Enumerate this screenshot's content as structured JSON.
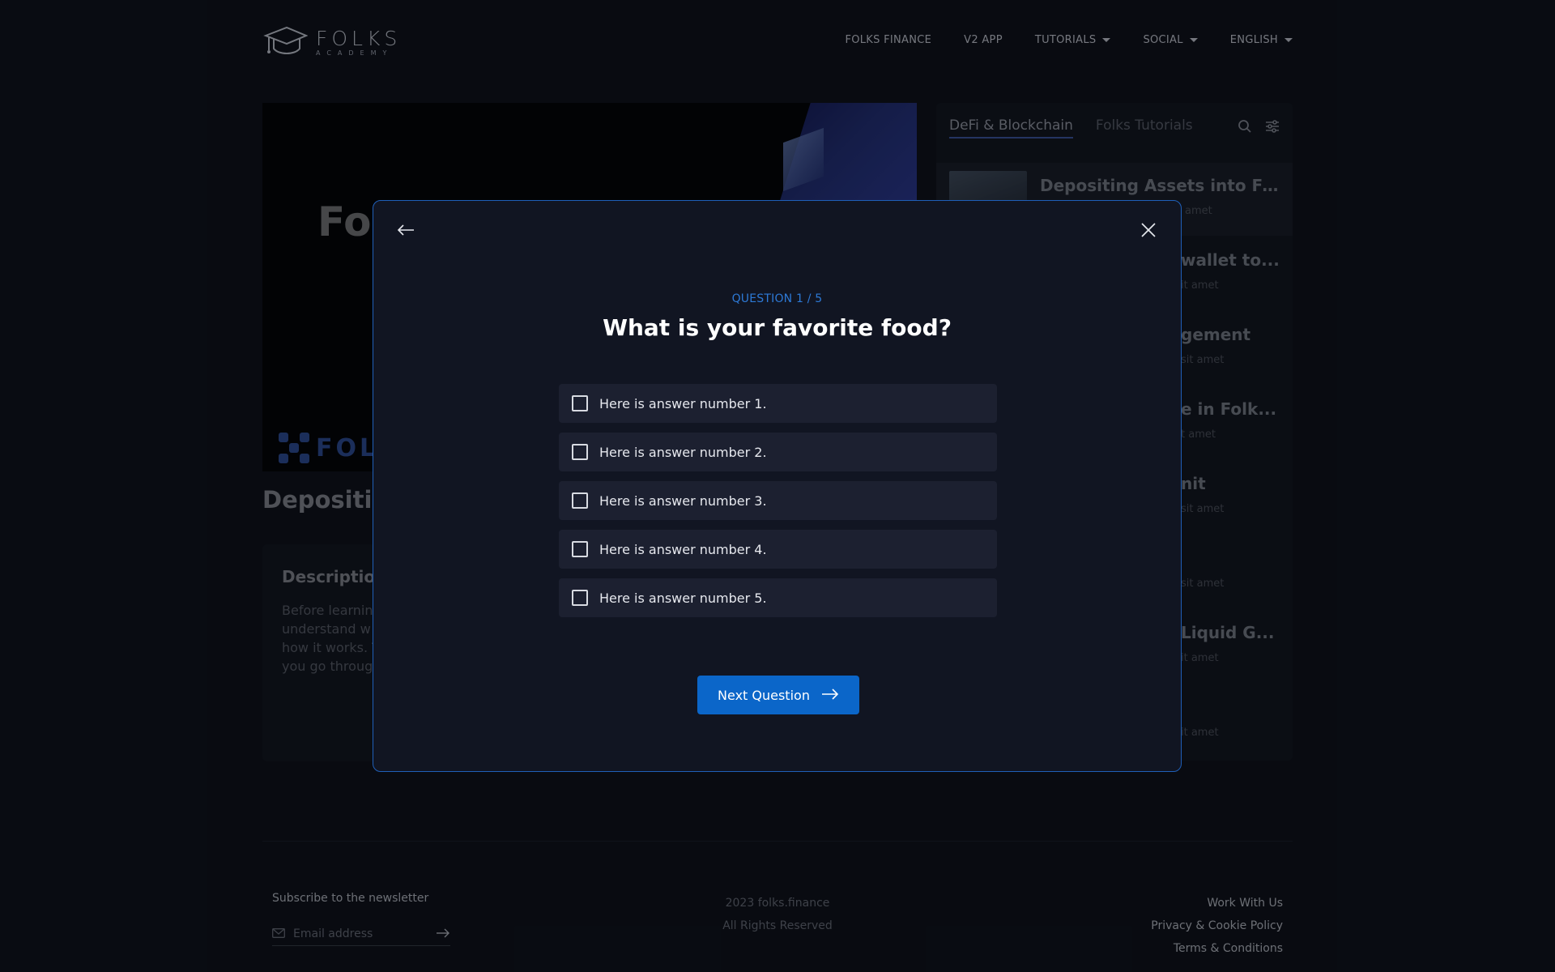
{
  "header": {
    "logo_main": "FOLKS",
    "logo_sub": "ACADEMY",
    "nav": [
      {
        "label": "FOLKS FINANCE",
        "dropdown": false
      },
      {
        "label": "V2 APP",
        "dropdown": false
      },
      {
        "label": "TUTORIALS",
        "dropdown": true
      },
      {
        "label": "SOCIAL",
        "dropdown": true
      },
      {
        "label": "ENGLISH",
        "dropdown": true
      }
    ]
  },
  "video": {
    "title_fragment": "Fol",
    "logo_fragment": "FOLK"
  },
  "article": {
    "title_fragment": "Depositin",
    "description_heading": "Description",
    "description_lines": [
      "Before learnin",
      "understand w",
      "how it works. T",
      "you go throug"
    ]
  },
  "sidebar": {
    "tabs": [
      {
        "label": "DeFi & Blockchain",
        "active": true
      },
      {
        "label": "Folks Tutorials",
        "active": false
      }
    ],
    "icons": [
      "search-icon",
      "filter-sliders-icon"
    ],
    "lessons": [
      {
        "title": "Depositing Assets into Fo...",
        "subtitle": "amet",
        "active": true
      },
      {
        "title": "wallet to...",
        "subtitle": "it amet"
      },
      {
        "title": "gement",
        "subtitle": "sit amet"
      },
      {
        "title": "e in Folk...",
        "subtitle": "t amet"
      },
      {
        "title": "nit",
        "subtitle": "sit amet"
      },
      {
        "title": "",
        "subtitle": "sit amet"
      },
      {
        "title": "Liquid G...",
        "subtitle": "it amet"
      },
      {
        "title": "",
        "subtitle": "it amet"
      }
    ]
  },
  "footer": {
    "newsletter_label": "Subscribe to the newsletter",
    "email_placeholder": "Email address",
    "copyright": "2023 folks.finance",
    "rights": "All Rights Reserved",
    "links": [
      "Work With Us",
      "Privacy & Cookie Policy",
      "Terms & Conditions"
    ]
  },
  "quiz": {
    "counter": "QUESTION 1 / 5",
    "question": "What is your favorite food?",
    "answers": [
      "Here is answer number 1.",
      "Here is answer number 2.",
      "Here is answer number 3.",
      "Here is answer number 4.",
      "Here is answer number 5."
    ],
    "next_label": "Next Question",
    "accent_color": "#0b66c9",
    "border_color": "#1f5fb8"
  }
}
